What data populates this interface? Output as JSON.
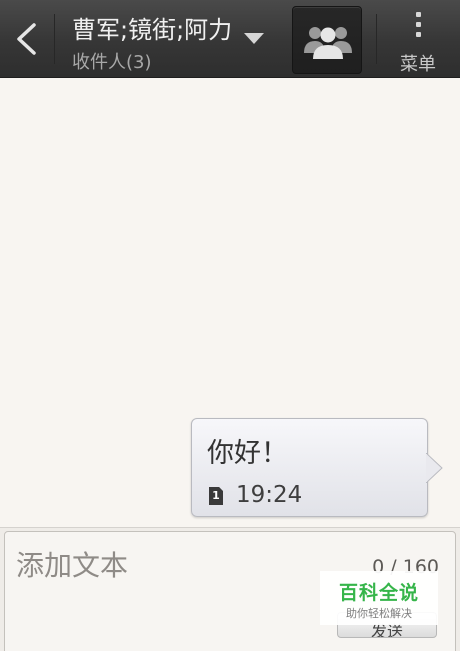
{
  "header": {
    "back_icon": "chevron-left-icon",
    "title": "曹军;镜街;阿力",
    "subtitle": "收件人(3)",
    "dropdown_icon": "caret-down-icon",
    "people_icon": "group-contacts-icon",
    "menu_label": "菜单",
    "menu_icon": "more-vertical-icon"
  },
  "conversation": {
    "messages": [
      {
        "text": "你好！",
        "sim_slot": "1",
        "time": "19:24"
      }
    ]
  },
  "compose": {
    "placeholder": "添加文本",
    "counter": "0 / 160",
    "send_label": "发送"
  },
  "watermark": {
    "title": "百科全说",
    "subtitle": "助你轻松解决"
  },
  "colors": {
    "header_bg": "#363636",
    "conversation_bg": "#f8f5f1",
    "watermark_green": "#36b54a"
  }
}
